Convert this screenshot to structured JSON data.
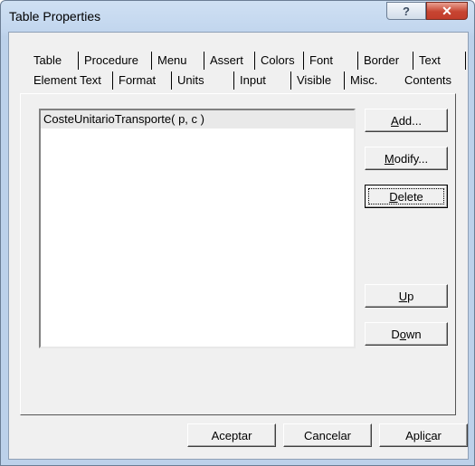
{
  "window": {
    "title": "Table Properties",
    "help_glyph": "?",
    "close_glyph": "✕"
  },
  "tabs_row1": [
    {
      "label": "Table"
    },
    {
      "label": "Procedure"
    },
    {
      "label": "Menu"
    },
    {
      "label": "Assert"
    },
    {
      "label": "Colors"
    },
    {
      "label": "Font"
    },
    {
      "label": "Border"
    },
    {
      "label": "Text"
    }
  ],
  "tabs_row2": [
    {
      "label": "Element Text"
    },
    {
      "label": "Format"
    },
    {
      "label": "Units"
    },
    {
      "label": "Input"
    },
    {
      "label": "Visible"
    },
    {
      "label": "Misc."
    },
    {
      "label": "Contents",
      "selected": true
    }
  ],
  "list": {
    "items": [
      "CosteUnitarioTransporte( p, c )"
    ]
  },
  "side_buttons": {
    "add": {
      "pre": "",
      "key": "A",
      "post": "dd..."
    },
    "modify": {
      "pre": "",
      "key": "M",
      "post": "odify..."
    },
    "delete": {
      "pre": "",
      "key": "D",
      "post": "elete"
    },
    "up": {
      "pre": "",
      "key": "U",
      "post": "p"
    },
    "down": {
      "pre": "D",
      "key": "o",
      "post": "wn"
    }
  },
  "footer": {
    "ok": "Aceptar",
    "cancel": "Cancelar",
    "apply_pre": "Apli",
    "apply_key": "c",
    "apply_post": "ar"
  }
}
